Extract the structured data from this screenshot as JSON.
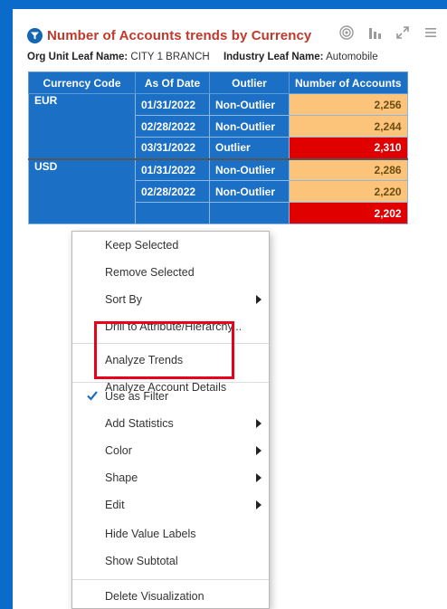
{
  "colors": {
    "frame": "#0b6bcb",
    "title": "#c0392b",
    "header": "#1b6fc4",
    "normal_cell": "#fbc47a",
    "outlier_cell": "#e00000",
    "highlight": "#e8001c"
  },
  "visualization": {
    "title": "Number of Accounts trends by Currency",
    "title_icon": "filter-funnel-icon",
    "toolbar_icons": [
      "target-icon",
      "bar-chart-icon",
      "maximize-icon",
      "menu-icon"
    ]
  },
  "filters": [
    {
      "label": "Org Unit Leaf Name:",
      "value": "CITY 1 BRANCH"
    },
    {
      "label": "Industry Leaf Name:",
      "value": "Automobile"
    }
  ],
  "table": {
    "columns": [
      "Currency Code",
      "As Of Date",
      "Outlier",
      "Number of Accounts"
    ],
    "groups": [
      {
        "currency": "EUR",
        "rows": [
          {
            "date": "01/31/2022",
            "outlier": "Non-Outlier",
            "accounts": "2,256",
            "status": "normal"
          },
          {
            "date": "02/28/2022",
            "outlier": "Non-Outlier",
            "accounts": "2,244",
            "status": "normal"
          },
          {
            "date": "03/31/2022",
            "outlier": "Outlier",
            "accounts": "2,310",
            "status": "outlier"
          }
        ]
      },
      {
        "currency": "USD",
        "rows": [
          {
            "date": "01/31/2022",
            "outlier": "Non-Outlier",
            "accounts": "2,286",
            "status": "normal"
          },
          {
            "date": "02/28/2022",
            "outlier": "Non-Outlier",
            "accounts": "2,220",
            "status": "normal"
          },
          {
            "date": "",
            "outlier": "",
            "accounts": "2,202",
            "status": "outlier"
          }
        ]
      }
    ]
  },
  "context_menu": {
    "items": [
      {
        "label": "Keep Selected",
        "submenu": false
      },
      {
        "label": "Remove Selected",
        "submenu": false
      },
      {
        "label": "Sort By",
        "submenu": true
      },
      {
        "label": "Drill to Attribute/Hierarchy...",
        "submenu": false
      },
      {
        "label": "Analyze Trends",
        "submenu": false
      },
      {
        "label": "Analyze Account Details",
        "submenu": false
      },
      {
        "label": "Use as Filter",
        "submenu": false,
        "checked": true
      },
      {
        "label": "Add Statistics",
        "submenu": true
      },
      {
        "label": "Color",
        "submenu": true
      },
      {
        "label": "Shape",
        "submenu": true
      },
      {
        "label": "Edit",
        "submenu": true
      },
      {
        "label": "Hide Value Labels",
        "submenu": false
      },
      {
        "label": "Show Subtotal",
        "submenu": false
      },
      {
        "label": "Delete Visualization",
        "submenu": false
      }
    ]
  }
}
